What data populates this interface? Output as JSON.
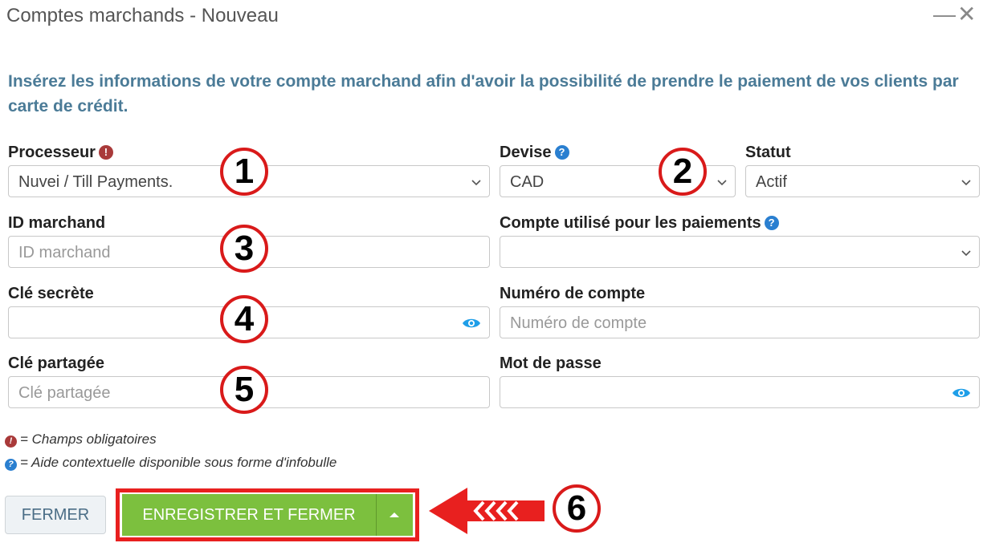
{
  "window": {
    "title": "Comptes marchands - Nouveau",
    "minimize_glyph": "—",
    "close_glyph": "✕"
  },
  "intro": "Insérez les informations de votre compte marchand afin d'avoir la possibilité de prendre le paiement de vos clients par carte de crédit.",
  "icons": {
    "required": "!",
    "help": "?"
  },
  "form": {
    "processeur": {
      "label": "Processeur",
      "value": "Nuvei / Till Payments."
    },
    "devise": {
      "label": "Devise",
      "value": "CAD"
    },
    "statut": {
      "label": "Statut",
      "value": "Actif"
    },
    "id_marchand": {
      "label": "ID marchand",
      "placeholder": "ID marchand",
      "value": ""
    },
    "compte_paiements": {
      "label": "Compte utilisé pour les paiements",
      "value": ""
    },
    "cle_secrete": {
      "label": "Clé secrète",
      "value": ""
    },
    "numero_compte": {
      "label": "Numéro de compte",
      "placeholder": "Numéro de compte",
      "value": ""
    },
    "cle_partagee": {
      "label": "Clé partagée",
      "placeholder": "Clé partagée",
      "value": ""
    },
    "mot_de_passe": {
      "label": "Mot de passe",
      "value": ""
    }
  },
  "legend": {
    "required": "= Champs obligatoires",
    "help": "= Aide contextuelle disponible sous forme d'infobulle"
  },
  "buttons": {
    "close": "FERMER",
    "save": "ENREGISTRER ET FERMER"
  },
  "annotations": [
    "1",
    "2",
    "3",
    "4",
    "5",
    "6"
  ],
  "colors": {
    "accent_green": "#7cc03e",
    "highlight_red": "#e8201f",
    "intro_blue": "#4b7b97",
    "required_red": "#a93a3a",
    "help_blue": "#2a7fd0",
    "eye_blue": "#1e9ee8"
  }
}
